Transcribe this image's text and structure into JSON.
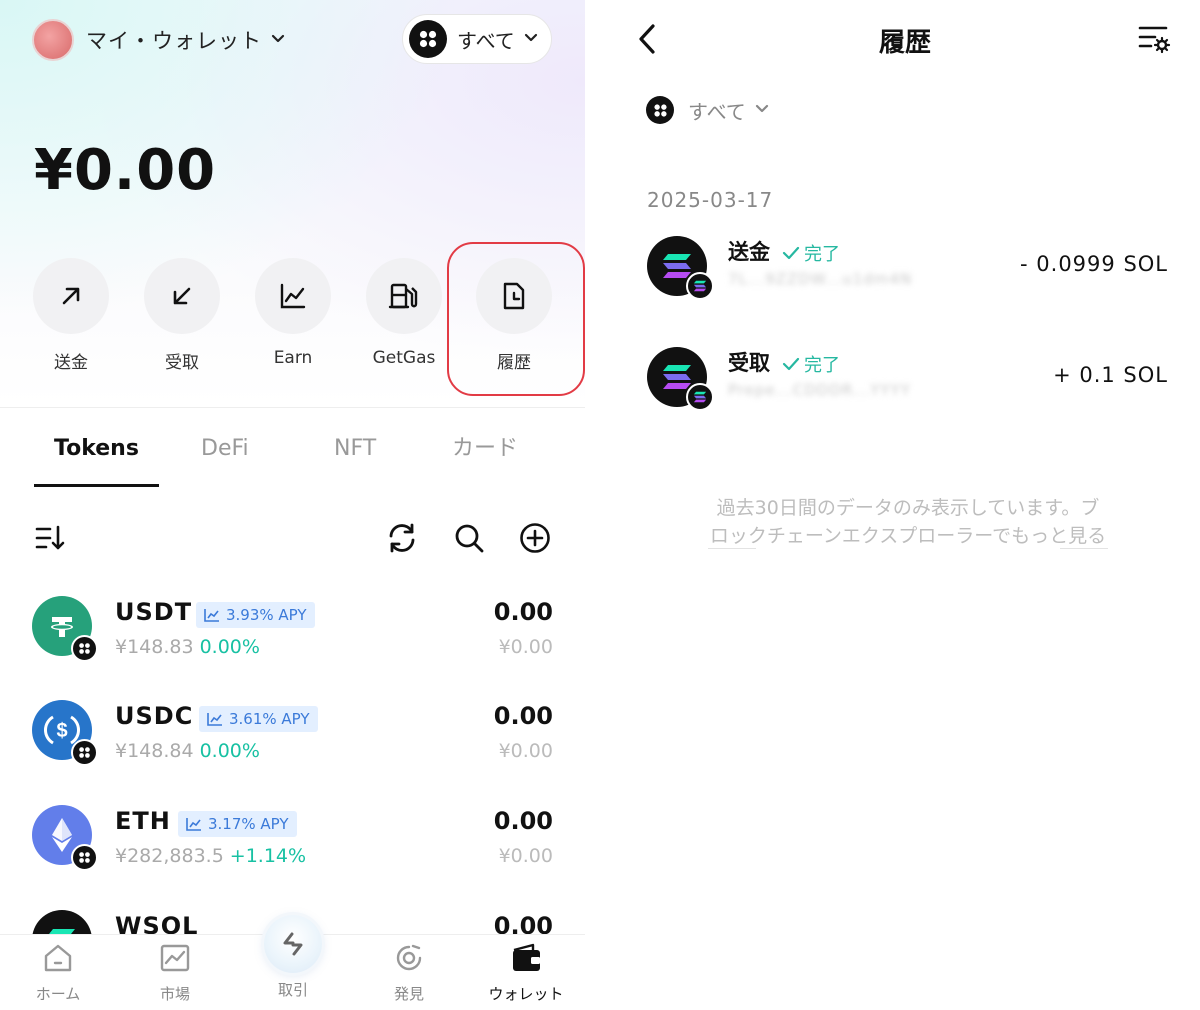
{
  "wallet": {
    "name": "マイ・ウォレット",
    "network_label": "すべて",
    "balance": "¥0.00"
  },
  "actions": [
    {
      "label": "送金",
      "icon": "arrow-up-right-icon"
    },
    {
      "label": "受取",
      "icon": "arrow-down-left-icon"
    },
    {
      "label": "Earn",
      "icon": "chart-line-icon"
    },
    {
      "label": "GetGas",
      "icon": "gas-pump-icon"
    },
    {
      "label": "履歴",
      "icon": "history-document-icon"
    }
  ],
  "tabs": [
    "Tokens",
    "DeFi",
    "NFT",
    "カード"
  ],
  "tokens": [
    {
      "symbol": "USDT",
      "apy": "3.93% APY",
      "price": "¥148.83",
      "change": "0.00%",
      "balance": "0.00",
      "value": "¥0.00",
      "color": "#26a17b"
    },
    {
      "symbol": "USDC",
      "apy": "3.61% APY",
      "price": "¥148.84",
      "change": "0.00%",
      "balance": "0.00",
      "value": "¥0.00",
      "color": "#2775ca"
    },
    {
      "symbol": "ETH",
      "apy": "3.17% APY",
      "price": "¥282,883.5",
      "change": "+1.14%",
      "balance": "0.00",
      "value": "¥0.00",
      "color": "#627eea"
    },
    {
      "symbol": "WSOL",
      "apy": "",
      "price": "",
      "change": "",
      "balance": "0.00",
      "value": "",
      "color": "#111111"
    }
  ],
  "bottom_nav": [
    {
      "label": "ホーム",
      "icon": "home-icon"
    },
    {
      "label": "市場",
      "icon": "market-chart-icon"
    },
    {
      "label": "取引",
      "icon": "swap-icon"
    },
    {
      "label": "発見",
      "icon": "discover-icon"
    },
    {
      "label": "ウォレット",
      "icon": "wallet-icon"
    }
  ],
  "history": {
    "title": "履歴",
    "network_filter": "すべて",
    "date": "2025-03-17",
    "transactions": [
      {
        "type": "送金",
        "status": "完了",
        "address": "7L...9ZZDW...u1dm4N",
        "amount": "- 0.0999  SOL"
      },
      {
        "type": "受取",
        "status": "完了",
        "address": "Prepe...CDDDR...YYYY",
        "amount": "+ 0.1  SOL"
      }
    ],
    "notice": "過去30日間のデータのみ表示しています。ブロックチェーンエクスプローラーでもっと見る"
  },
  "colors": {
    "accent_teal": "#18c1a3",
    "apy_blue": "#3b7ad9",
    "highlight_red": "#e23b45"
  }
}
